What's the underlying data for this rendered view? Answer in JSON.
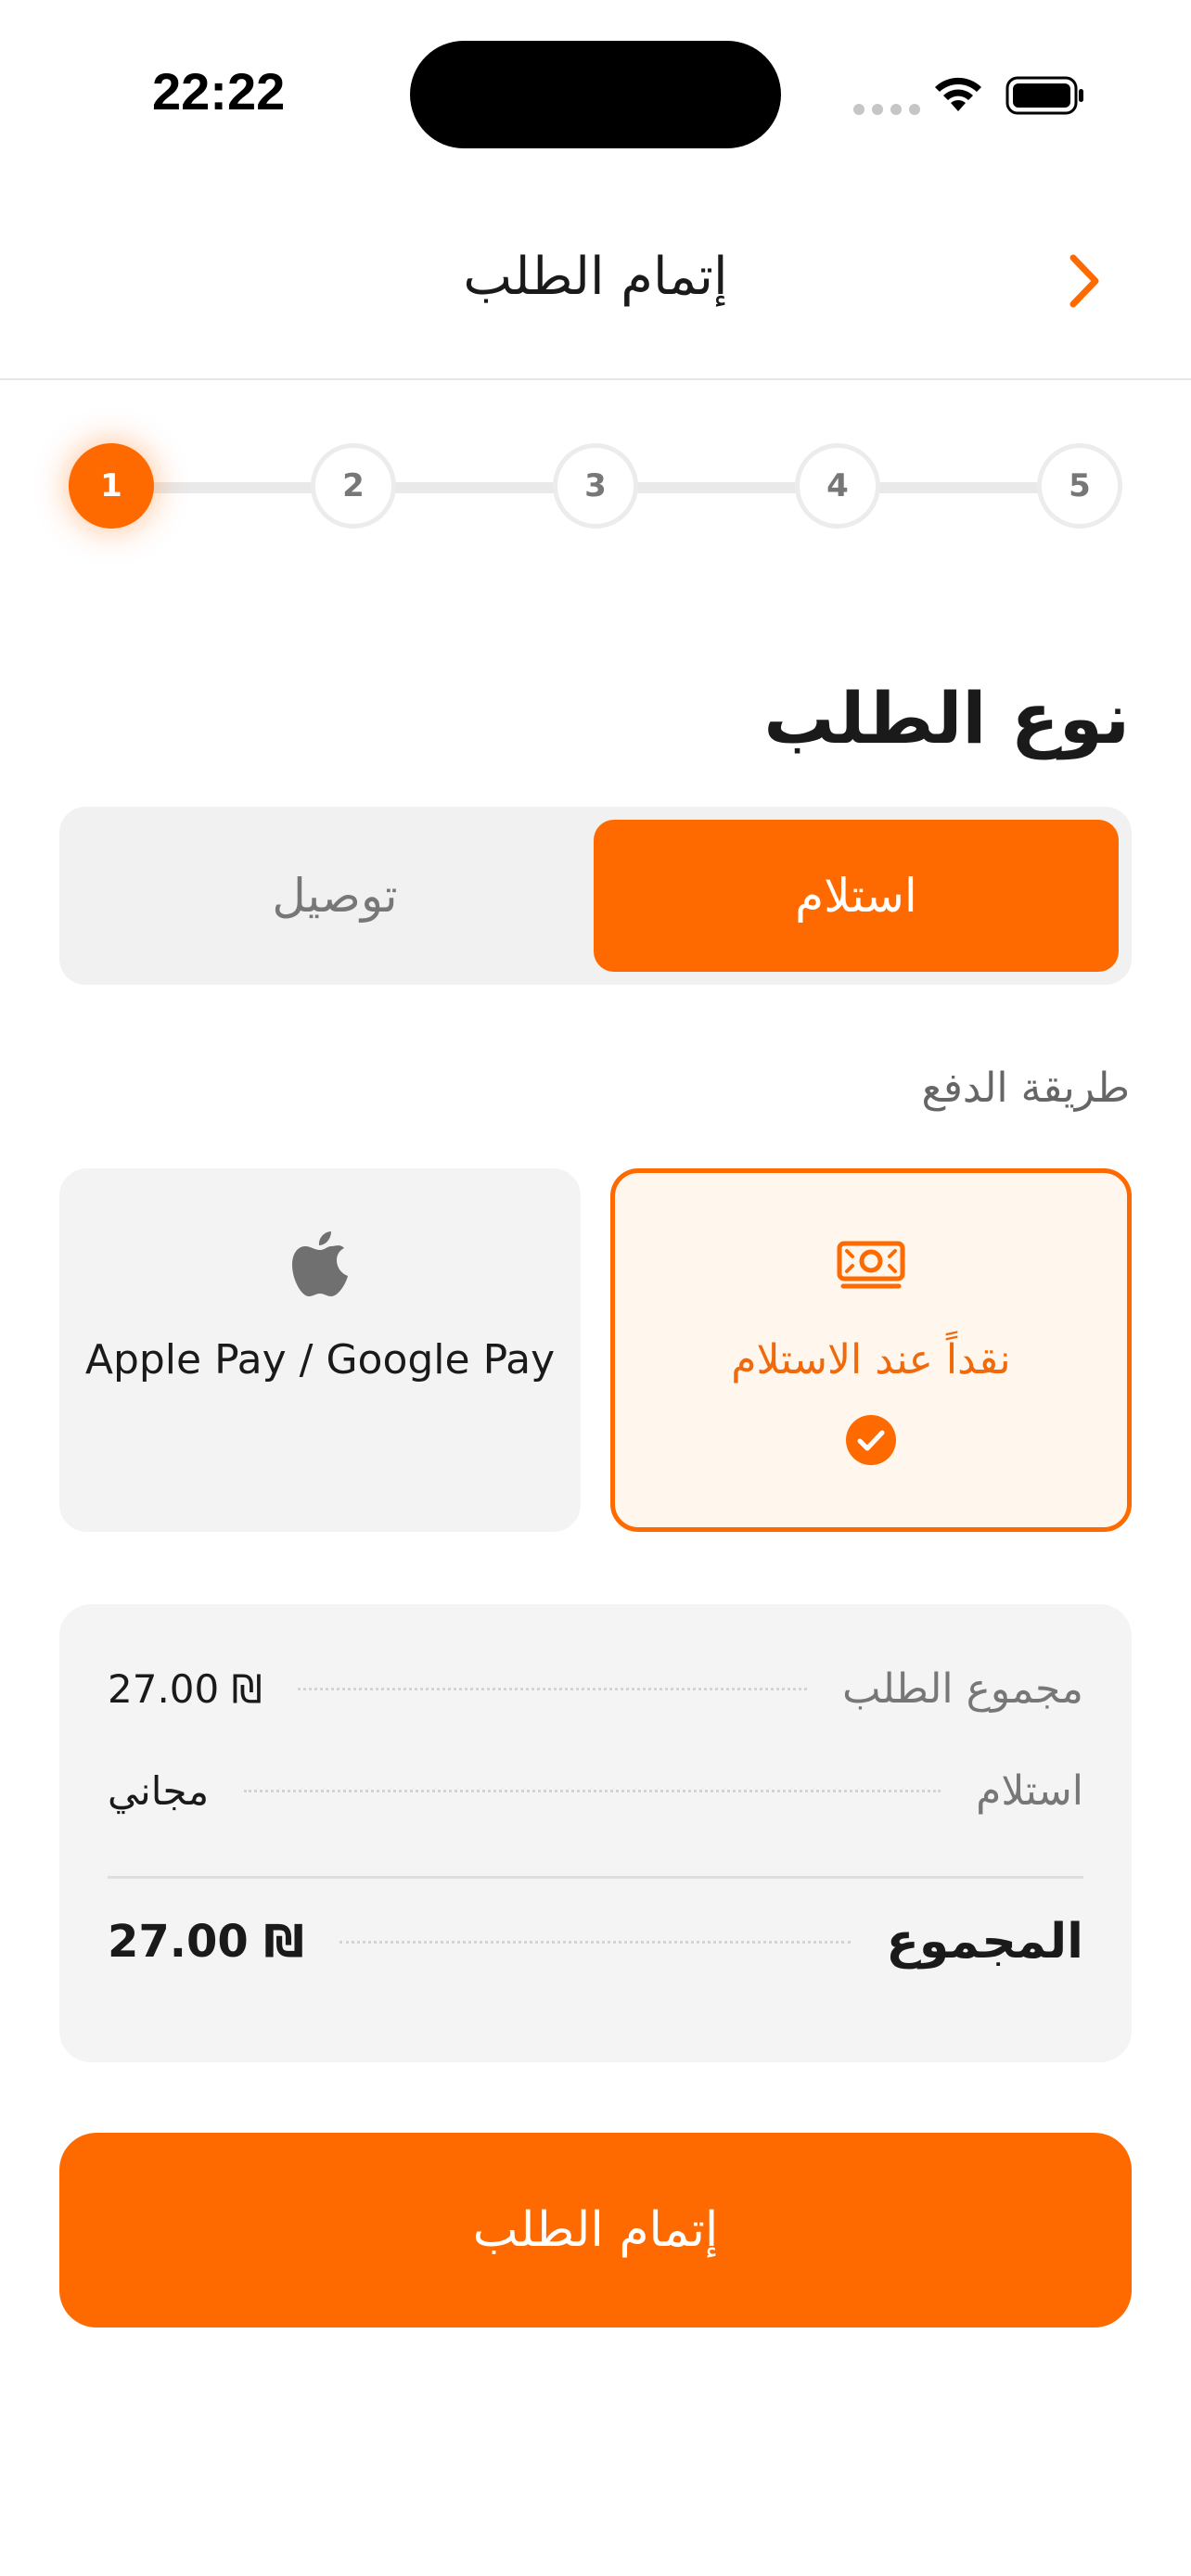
{
  "status_bar": {
    "time": "22:22"
  },
  "header": {
    "title": "إتمام الطلب"
  },
  "stepper": {
    "steps": [
      "1",
      "2",
      "3",
      "4",
      "5"
    ],
    "active_step": "1"
  },
  "order_type": {
    "title": "نوع الطلب",
    "options": [
      {
        "label": "استلام",
        "selected": true
      },
      {
        "label": "توصيل",
        "selected": false
      }
    ]
  },
  "payment": {
    "label": "طريقة الدفع",
    "methods": [
      {
        "label": "نقداً عند الاستلام",
        "icon": "cash-icon",
        "selected": true
      },
      {
        "label": "Apple Pay / Google Pay",
        "icon": "apple-icon",
        "selected": false
      }
    ]
  },
  "summary": {
    "subtotal_label": "مجموع الطلب",
    "subtotal_value": "27.00 ₪",
    "pickup_label": "استلام",
    "pickup_value": "مجاني",
    "total_label": "المجموع",
    "total_value": "27.00 ₪"
  },
  "submit": {
    "label": "إتمام الطلب"
  },
  "colors": {
    "accent": "#ff6a00",
    "accent_light": "#fff6ee",
    "surface": "#f3f3f3"
  }
}
